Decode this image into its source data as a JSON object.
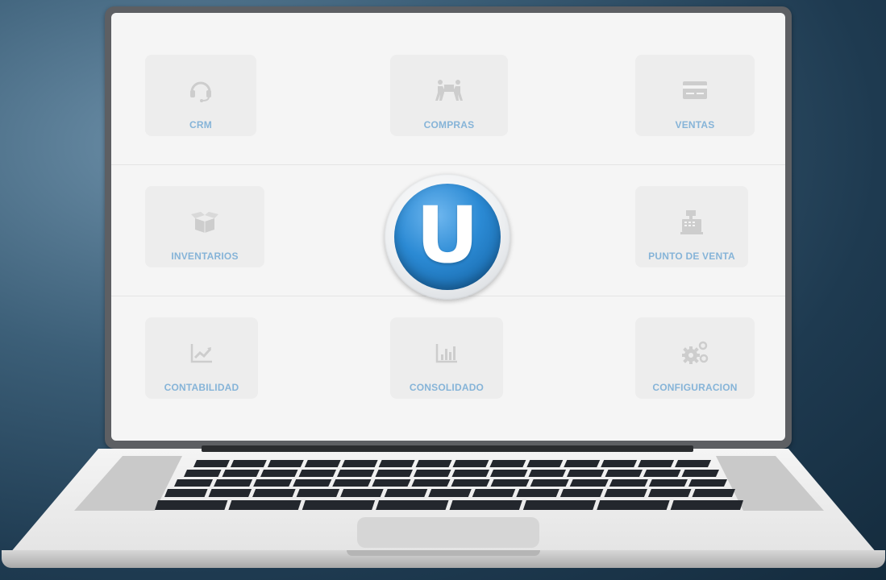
{
  "modules": {
    "crm": {
      "label": "CRM",
      "icon": "headset-icon"
    },
    "compras": {
      "label": "COMPRAS",
      "icon": "people-carry-box-icon"
    },
    "ventas": {
      "label": "VENTAS",
      "icon": "credit-card-icon"
    },
    "inventarios": {
      "label": "INVENTARIOS",
      "icon": "open-box-icon"
    },
    "punto_venta": {
      "label": "PUNTO DE VENTA",
      "icon": "cash-register-icon"
    },
    "contabilidad": {
      "label": "CONTABILIDAD",
      "icon": "line-chart-icon"
    },
    "consolidado": {
      "label": "CONSOLIDADO",
      "icon": "bar-chart-icon"
    },
    "configuracion": {
      "label": "CONFIGURACION",
      "icon": "gears-icon"
    }
  },
  "logo": {
    "letter": "U"
  },
  "colors": {
    "label": "#86b4d8",
    "icon": "#cdcdcd",
    "tile": "#ededed",
    "logo_blue": "#2b8ad4"
  }
}
